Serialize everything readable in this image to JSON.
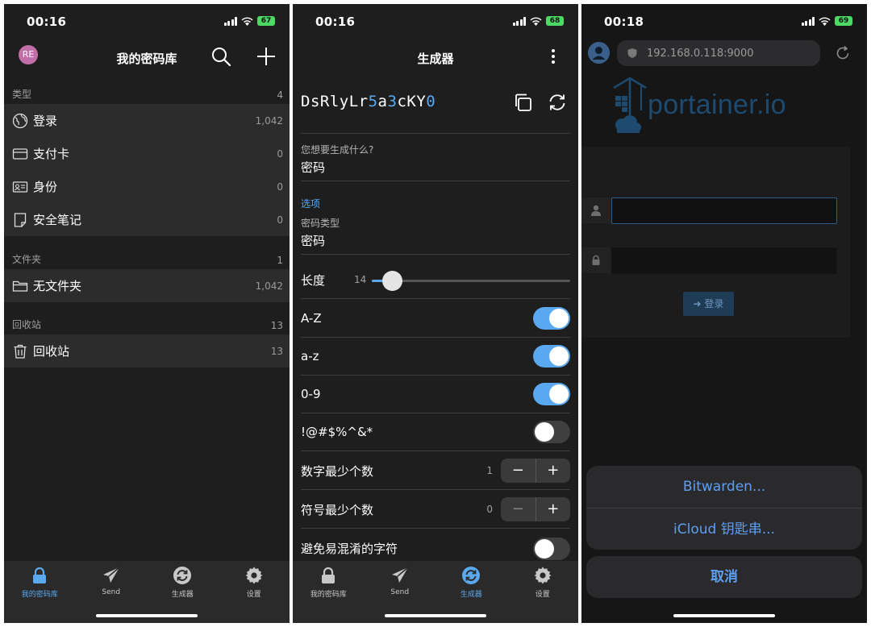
{
  "vault_screen": {
    "status": {
      "time": "00:16",
      "battery": "67"
    },
    "avatar_initials": "RE",
    "title": "我的密码库",
    "types_header": {
      "label": "类型",
      "count": "4"
    },
    "types": [
      {
        "label": "登录",
        "count": "1,042",
        "icon": "globe-icon"
      },
      {
        "label": "支付卡",
        "count": "0",
        "icon": "card-icon"
      },
      {
        "label": "身份",
        "count": "0",
        "icon": "id-card-icon"
      },
      {
        "label": "安全笔记",
        "count": "0",
        "icon": "note-icon"
      }
    ],
    "folders_header": {
      "label": "文件夹",
      "count": "1"
    },
    "folders": [
      {
        "label": "无文件夹",
        "count": "1,042",
        "icon": "folder-icon"
      }
    ],
    "trash_header": {
      "label": "回收站",
      "count": "13"
    },
    "trash": [
      {
        "label": "回收站",
        "count": "13",
        "icon": "trash-icon"
      }
    ],
    "tabs": [
      {
        "label": "我的密码库",
        "icon": "lock-icon",
        "active": true
      },
      {
        "label": "Send",
        "icon": "send-icon",
        "active": false
      },
      {
        "label": "生成器",
        "icon": "refresh-icon",
        "active": false
      },
      {
        "label": "设置",
        "icon": "gear-icon",
        "active": false
      }
    ]
  },
  "generator_screen": {
    "status": {
      "time": "00:16",
      "battery": "68"
    },
    "title": "生成器",
    "password_parts": [
      {
        "text": "DsRlyLr",
        "num": false
      },
      {
        "text": "5",
        "num": true
      },
      {
        "text": "a",
        "num": false
      },
      {
        "text": "3",
        "num": true
      },
      {
        "text": "cKY",
        "num": false
      },
      {
        "text": "0",
        "num": true
      }
    ],
    "what_label": "您想要生成什么?",
    "what_value": "密码",
    "options_label": "选项",
    "pw_type_label": "密码类型",
    "pw_type_value": "密码",
    "length_label": "长度",
    "length_value": "14",
    "length_fraction": 0.1,
    "toggles": [
      {
        "label": "A-Z",
        "on": true
      },
      {
        "label": "a-z",
        "on": true
      },
      {
        "label": "0-9",
        "on": true
      },
      {
        "label": "!@#$%^&*",
        "on": false
      }
    ],
    "min_numbers": {
      "label": "数字最少个数",
      "value": "1"
    },
    "min_special": {
      "label": "符号最少个数",
      "value": "0"
    },
    "stepper_minus": "−",
    "stepper_plus": "+",
    "avoid_ambiguous": {
      "label": "避免易混淆的字符",
      "on": false
    },
    "tabs": [
      {
        "label": "我的密码库",
        "icon": "lock-icon",
        "active": false
      },
      {
        "label": "Send",
        "icon": "send-icon",
        "active": false
      },
      {
        "label": "生成器",
        "icon": "refresh-icon",
        "active": true
      },
      {
        "label": "设置",
        "icon": "gear-icon",
        "active": false
      }
    ]
  },
  "browser_screen": {
    "status": {
      "time": "00:18",
      "battery": "69"
    },
    "url": "192.168.0.118:9000",
    "logo_text": "portainer.io",
    "login_button": "登录",
    "sheet_options": [
      "Bitwarden...",
      "iCloud 钥匙串..."
    ],
    "cancel": "取消"
  },
  "colors": {
    "accent": "#5aa9f0",
    "background": "#1e1e1e",
    "row": "#2c2c2c",
    "battery": "#4cd964",
    "portainer": "#1d4a6e"
  }
}
